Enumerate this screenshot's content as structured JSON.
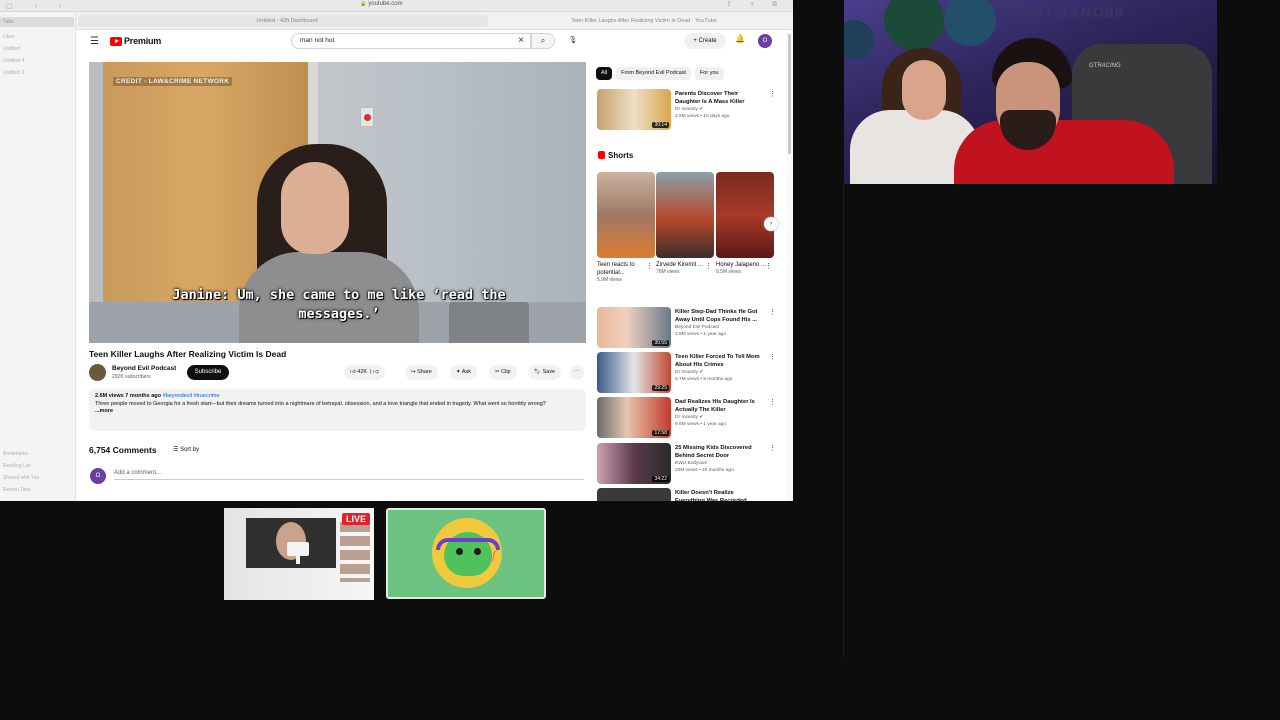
{
  "browser": {
    "url": "youtube.com",
    "tabs": [
      "Untitled - 42ft Dashboard",
      "Teen Killer Laughs After Realizing Victim Is Dead - YouTube"
    ],
    "sidebar": {
      "top_items": [
        "Tabs",
        "Likes",
        "Untitled",
        "Untitled 4",
        "Untitled 3"
      ],
      "bottom_items": [
        "Bookmarks",
        "Reading List",
        "Shared with You",
        "Recent Tabs"
      ]
    }
  },
  "yt": {
    "logo_text": "Premium",
    "search_value": "man not hot",
    "create_label": "Create",
    "avatar_letter": "O",
    "video": {
      "credit": "CREDIT - LAW&CRIME NETWORK",
      "caption": "Janine: Um, she came to me like ‘read the messages.’",
      "title": "Teen Killer Laughs After Realizing Victim Is Dead"
    },
    "channel": {
      "name": "Beyond Evil Podcast",
      "subs": "292K subscribers",
      "subscribe_label": "Subscribe"
    },
    "actions": {
      "likes": "42K",
      "share": "Share",
      "ask": "Ask",
      "clip": "Clip",
      "save": "Save"
    },
    "description": {
      "meta": "2.6M views  7 months ago",
      "tags": "#beyondevil #truecrime",
      "text": "Three people moved to Georgia for a fresh start—but their dreams turned into a nightmare of betrayal, obsession, and a love triangle that ended in tragedy. What went so horribly wrong?",
      "more": "...more"
    },
    "comments": {
      "count": "6,754 Comments",
      "sort": "Sort by",
      "add_placeholder": "Add a comment..."
    },
    "chips": [
      "All",
      "From Beyond Evil Podcast",
      "For you"
    ],
    "shorts_header": "Shorts",
    "shorts": [
      {
        "title": "Teen reacts to potential...",
        "views": "5.9M views"
      },
      {
        "title": "Zirvede Kiremit ...",
        "views": "76M views"
      },
      {
        "title": "Honey Jalapeno ...",
        "views": "9.5M views"
      }
    ],
    "recs": [
      {
        "title": "Parents Discover Their Daughter Is A Mass Killer",
        "channel": "Dr Insanity",
        "views": "2.9M views • 10 days ago",
        "dur": "30:14"
      },
      {
        "title": "Killer Step-Dad Thinks He Got Away Until Cops Found His ...",
        "channel": "Beyond Evil Podcast",
        "views": "2.8M views • 1 year ago",
        "dur": "30:55"
      },
      {
        "title": "Teen Killer Forced To Tell Mom About His Crimes",
        "channel": "Dr Insanity",
        "views": "5.7M views • 8 months ago",
        "dur": "29:25"
      },
      {
        "title": "Dad Realizes His Daughter Is Actually The Killer",
        "channel": "Dr Insanity",
        "views": "9.6M views • 1 year ago",
        "dur": "17:58"
      },
      {
        "title": "25 Missing Kids Discovered Behind Secret Door",
        "channel": "EWU Bodycam",
        "views": "20M views • 10 months ago",
        "dur": "34:22"
      },
      {
        "title": "Killer Doesn't Realize Everything Was Recorded",
        "channel": "",
        "views": "",
        "dur": ""
      }
    ]
  },
  "webcam": {
    "tag": "JUST JANO99",
    "chair_text": "GTRACING"
  },
  "stream": {
    "live_label": "LIVE"
  }
}
